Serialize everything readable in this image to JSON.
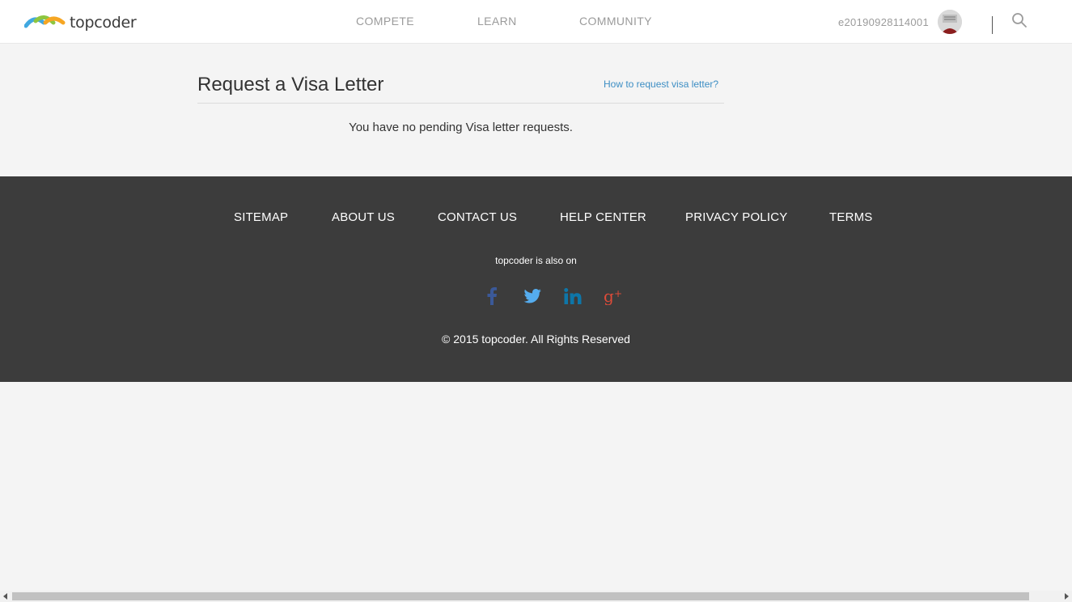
{
  "header": {
    "logo_text": "topcoder",
    "nav": [
      {
        "label": "COMPETE"
      },
      {
        "label": "LEARN"
      },
      {
        "label": "COMMUNITY"
      }
    ],
    "username": "e20190928114001",
    "icons": {
      "search": "search-icon",
      "avatar": "user-avatar"
    }
  },
  "main": {
    "title": "Request a Visa Letter",
    "help_link": "How to request visa letter?",
    "empty_message": "You have no pending Visa letter requests."
  },
  "footer": {
    "links": [
      {
        "label": "SITEMAP"
      },
      {
        "label": "ABOUT US"
      },
      {
        "label": "CONTACT US"
      },
      {
        "label": "HELP CENTER"
      },
      {
        "label": "PRIVACY POLICY"
      },
      {
        "label": "TERMS"
      }
    ],
    "also_on": "topcoder is also on",
    "social": [
      {
        "icon": "facebook-icon",
        "color": "#3b5998"
      },
      {
        "icon": "twitter-icon",
        "color": "#55acee"
      },
      {
        "icon": "linkedin-icon",
        "color": "#0e76a8"
      },
      {
        "icon": "googleplus-icon",
        "color": "#dd4b39"
      }
    ],
    "copyright": "© 2015 topcoder. All Rights Reserved"
  },
  "colors": {
    "accent_link": "#3d8ec4",
    "footer_bg": "#3c3c3c",
    "page_bg": "#f4f4f4"
  }
}
